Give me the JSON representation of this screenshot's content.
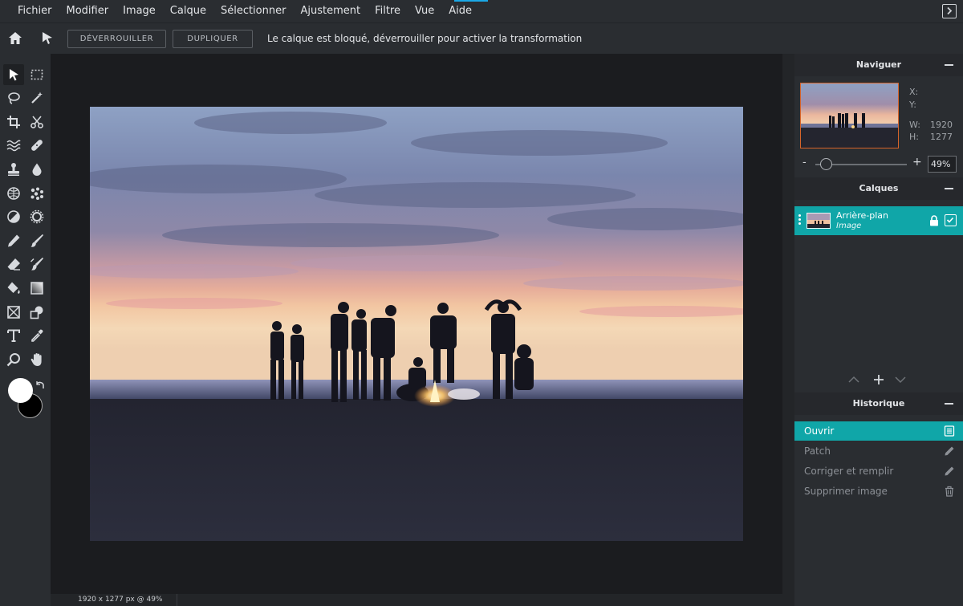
{
  "menu": {
    "items": [
      "Fichier",
      "Modifier",
      "Image",
      "Calque",
      "Sélectionner",
      "Ajustement",
      "Filtre",
      "Vue",
      "Aide"
    ]
  },
  "options_bar": {
    "unlock_label": "DÉVERROUILLER",
    "duplicate_label": "DUPLIQUER",
    "message": "Le calque est bloqué, déverrouiller pour activer la transformation"
  },
  "toolbox": {
    "tools": [
      "move-tool-icon",
      "marquee-select-icon",
      "lasso-icon",
      "magic-wand-icon",
      "crop-icon",
      "scissors-icon",
      "liquify-icon",
      "healing-patch-icon",
      "clone-stamp-icon",
      "blur-drop-icon",
      "sponge-icon",
      "pattern-icon",
      "dodge-burn-icon",
      "sharpen-icon",
      "pencil-icon",
      "brush-icon",
      "eraser-icon",
      "color-replace-icon",
      "paint-bucket-icon",
      "gradient-icon",
      "frame-icon",
      "shape-icon",
      "text-icon",
      "eyedropper-icon",
      "zoom-icon",
      "hand-icon"
    ],
    "foreground_color": "#ffffff",
    "background_color": "#000000"
  },
  "status": {
    "text": "1920 x 1277 px @ 49%"
  },
  "navigator": {
    "title": "Naviguer",
    "x_label": "X:",
    "y_label": "Y:",
    "w_label": "W:",
    "w_value": "1920",
    "h_label": "H:",
    "h_value": "1277",
    "zoom_minus": "-",
    "zoom_plus": "+",
    "zoom_value": "49%",
    "zoom_fraction": 0.49
  },
  "layers": {
    "title": "Calques",
    "items": [
      {
        "name": "Arrière-plan",
        "type": "Image",
        "locked": true,
        "visible": true
      }
    ]
  },
  "history": {
    "title": "Historique",
    "items": [
      {
        "label": "Ouvrir",
        "icon": "document-icon",
        "state": "current"
      },
      {
        "label": "Patch",
        "icon": "pencil-icon",
        "state": "future"
      },
      {
        "label": "Corriger et remplir",
        "icon": "pencil-icon",
        "state": "future"
      },
      {
        "label": "Supprimer image",
        "icon": "trash-icon",
        "state": "future"
      }
    ]
  },
  "colors": {
    "accent": "#10a6a8",
    "panel_bg": "#2a2d31",
    "workspace_bg": "#1b1c1f"
  }
}
